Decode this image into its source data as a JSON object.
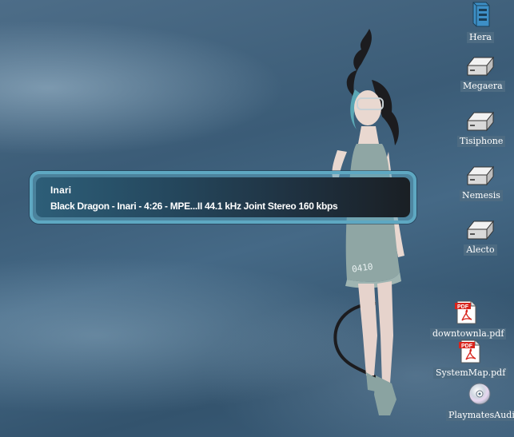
{
  "osd": {
    "title": "Inari",
    "detail": "Black Dragon - Inari - 4:26 - MPE...II 44.1 kHz Joint Stereo 160 kbps"
  },
  "wallpaper": {
    "dress_text": "0410"
  },
  "desktop_icons": [
    {
      "label": "Hera",
      "icon": "computer-icon"
    },
    {
      "label": "Megaera",
      "icon": "hard-drive-icon"
    },
    {
      "label": "Tisiphone",
      "icon": "hard-drive-icon"
    },
    {
      "label": "Nemesis",
      "icon": "hard-drive-icon"
    },
    {
      "label": "Alecto",
      "icon": "hard-drive-icon"
    },
    {
      "label": "downtownla.pdf",
      "icon": "pdf-file-icon"
    },
    {
      "label": "SystemMap.pdf",
      "icon": "pdf-file-icon"
    },
    {
      "label": "PlaymatesAudio",
      "icon": "audio-cd-icon"
    }
  ],
  "colors": {
    "label_background": "#4d6b82",
    "osd_border": "#5ea8c2",
    "desktop": "#3a5a74"
  }
}
